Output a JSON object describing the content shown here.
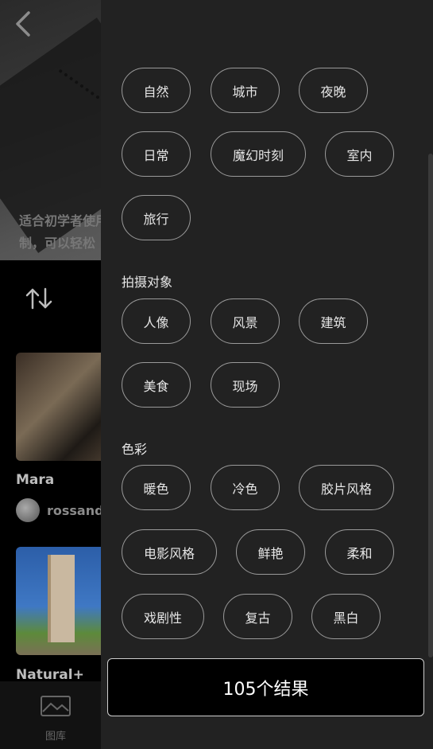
{
  "background": {
    "hero_text": "适合初学者使用的预设，强大而又易于控制，可以轻松",
    "cards": [
      {
        "title": "Mara",
        "author": "rossandl"
      },
      {
        "title": "Natural+",
        "author": ""
      }
    ],
    "nav": {
      "library_label": "图库"
    },
    "icons": {
      "back": "back-arrow-icon",
      "sort": "sort-arrows-icon",
      "library": "image-icon"
    }
  },
  "filters": {
    "scene_chips": [
      "自然",
      "城市",
      "夜晚",
      "日常",
      "魔幻时刻",
      "室内",
      "旅行"
    ],
    "subject_title": "拍摄对象",
    "subject_chips": [
      "人像",
      "风景",
      "建筑",
      "美食",
      "现场"
    ],
    "color_title": "色彩",
    "color_chips": [
      "暖色",
      "冷色",
      "胶片风格",
      "电影风格",
      "鲜艳",
      "柔和",
      "戏剧性",
      "复古",
      "黑白"
    ]
  },
  "result_button": "105个结果",
  "colors": {
    "drawer_bg": "#222222",
    "chip_border": "#9a9a9a",
    "text": "#e6e6e6"
  }
}
